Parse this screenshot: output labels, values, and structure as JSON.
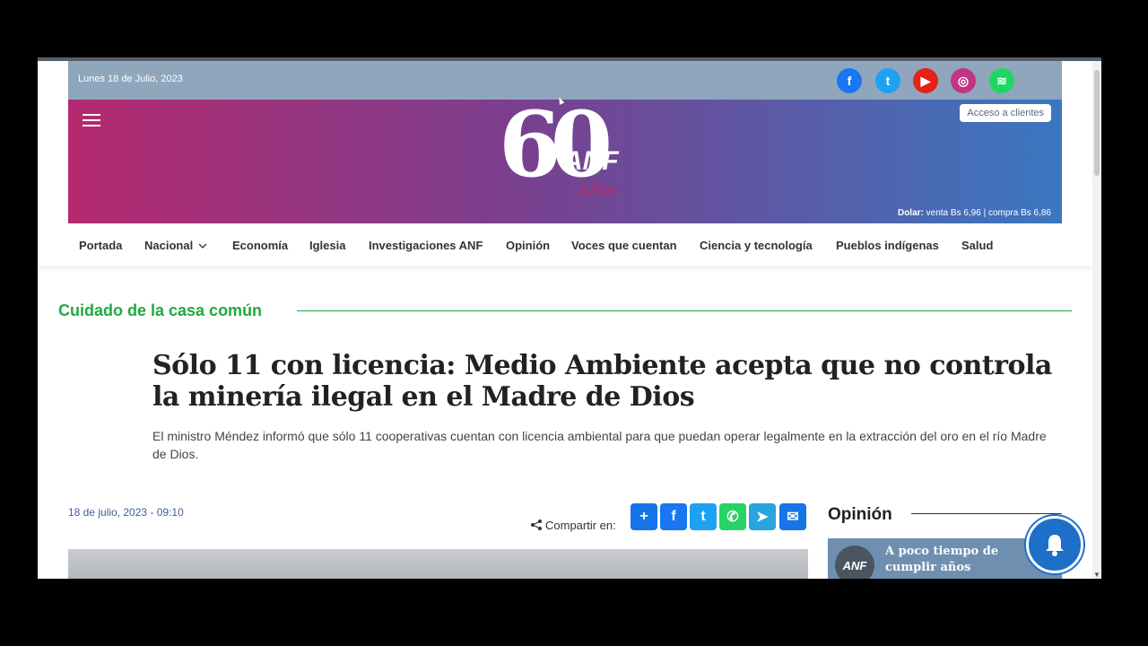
{
  "topbar": {
    "date": "Lunes 18 de Julio, 2023",
    "social": [
      {
        "icon": "facebook-icon",
        "glyph": "f",
        "color": "#1877f2"
      },
      {
        "icon": "twitter-icon",
        "glyph": "t",
        "color": "#1da1f2"
      },
      {
        "icon": "youtube-icon",
        "glyph": "▶",
        "color": "#e62117"
      },
      {
        "icon": "instagram-icon",
        "glyph": "◎",
        "color": "#c13584"
      },
      {
        "icon": "spotify-icon",
        "glyph": "≋",
        "color": "#1ed760"
      }
    ]
  },
  "banner": {
    "acceso": "Acceso a clientes",
    "logo_number": "60",
    "logo_brand": "ANF",
    "logo_anos": "años",
    "dolar_label": "Dolar:",
    "dolar_value": " venta Bs 6,96 | compra Bs 6,86"
  },
  "nav": [
    "Portada",
    "Nacional",
    "Economía",
    "Iglesia",
    "Investigaciones ANF",
    "Opinión",
    "Voces que cuentan",
    "Ciencia y tecnología",
    "Pueblos indígenas",
    "Salud"
  ],
  "article": {
    "section": "Cuidado de la casa común",
    "headline": "Sólo 11 con licencia: Medio Ambiente acepta que no controla la minería ilegal en el Madre de Dios",
    "lede": "El ministro Méndez informó que sólo 11 cooperativas cuentan con licencia ambiental para que puedan operar legalmente en la extracción del oro en el río Madre de Dios.",
    "date": "18 de julio, 2023 - 09:10",
    "share_label": "Compartir en:"
  },
  "share_buttons": [
    {
      "icon": "add-share-icon",
      "glyph": "+",
      "color": "#1574e8"
    },
    {
      "icon": "facebook-share-icon",
      "glyph": "f",
      "color": "#1877f2"
    },
    {
      "icon": "twitter-share-icon",
      "glyph": "t",
      "color": "#1da1f2"
    },
    {
      "icon": "whatsapp-share-icon",
      "glyph": "✆",
      "color": "#25d366"
    },
    {
      "icon": "telegram-share-icon",
      "glyph": "➤",
      "color": "#2aa3df"
    },
    {
      "icon": "email-share-icon",
      "glyph": "✉",
      "color": "#1574e8"
    }
  ],
  "opinion": {
    "title": "Opinión",
    "avatar": "ANF",
    "card_text": "A poco tiempo de cumplir años"
  }
}
